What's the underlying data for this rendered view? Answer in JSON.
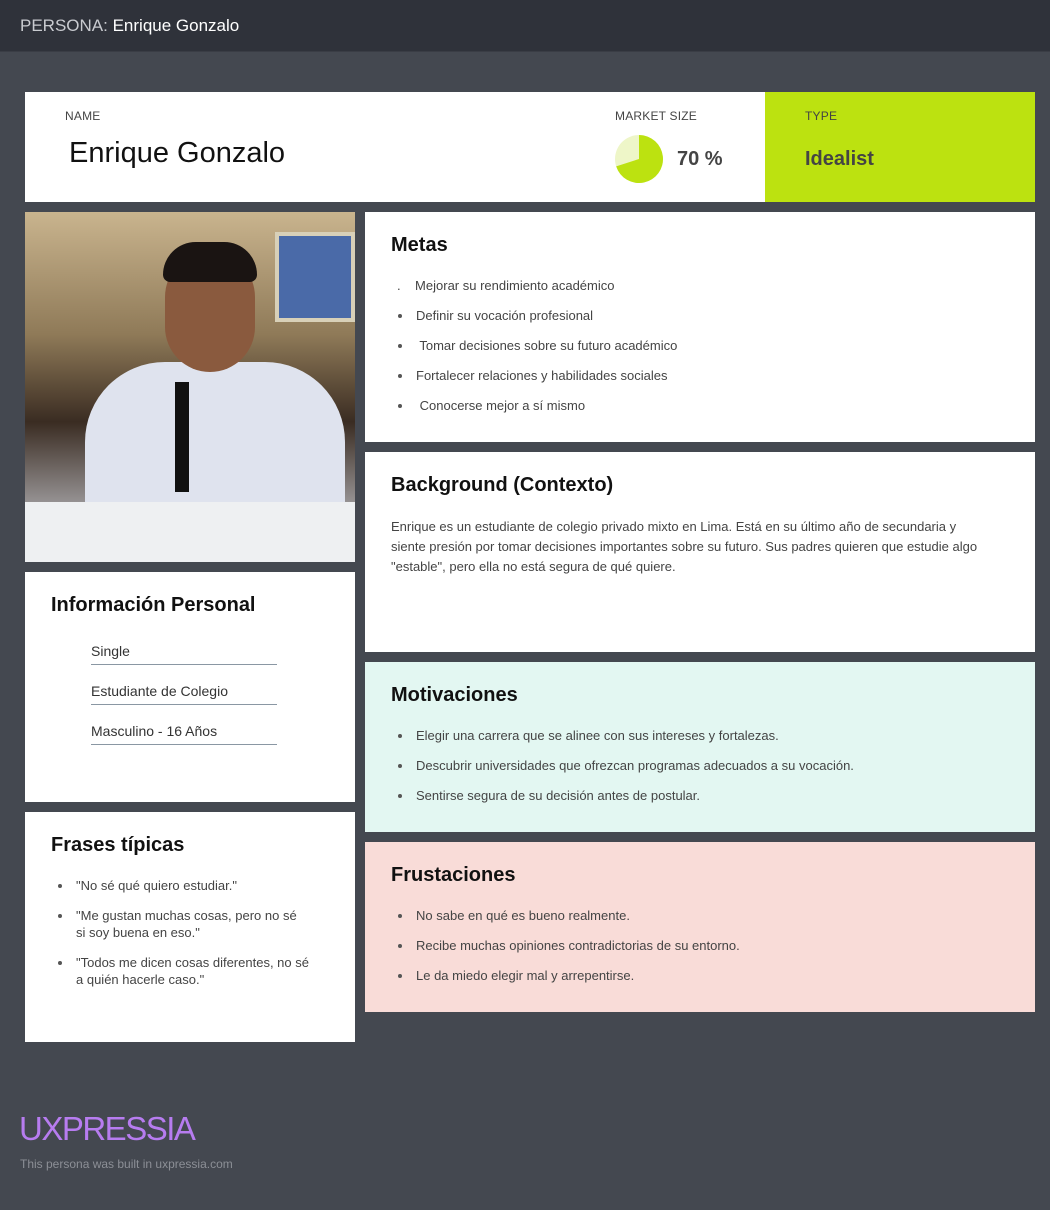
{
  "header": {
    "prefix": "PERSONA:",
    "name": "Enrique Gonzalo"
  },
  "summary": {
    "name_label": "NAME",
    "name": "Enrique Gonzalo",
    "market_label": "MARKET SIZE",
    "market_value": "70 %",
    "market_fraction": 0.7,
    "type_label": "TYPE",
    "type": "Idealist"
  },
  "colors": {
    "accent": "#bce210",
    "motivations_bg": "#e3f7f2",
    "frustrations_bg": "#f9dcd8",
    "brand": "#b77cf0"
  },
  "goals": {
    "title": "Metas",
    "items": [
      ".    Mejorar su rendimiento académico",
      "Definir su vocación profesional",
      " Tomar decisiones sobre su futuro académico",
      "Fortalecer relaciones y habilidades sociales",
      " Conocerse mejor a sí mismo"
    ]
  },
  "background": {
    "title": "Background (Contexto)",
    "text": "Enrique es un estudiante de colegio privado mixto en Lima. Está en su último año de secundaria y siente presión por tomar decisiones importantes sobre su futuro. Sus padres quieren que estudie algo \"estable\", pero ella no está segura de qué quiere."
  },
  "personal": {
    "title": "Información Personal",
    "fields": [
      "Single",
      "Estudiante de Colegio",
      "Masculino - 16 Años"
    ]
  },
  "quotes": {
    "title": "Frases típicas",
    "items": [
      "\"No sé qué quiero estudiar.\"",
      "\"Me gustan muchas cosas, pero no sé si soy buena en eso.\"",
      "\"Todos me dicen cosas diferentes, no sé a quién hacerle caso.\""
    ]
  },
  "motivations": {
    "title": "Motivaciones",
    "items": [
      "Elegir una carrera que se alinee con sus intereses y fortalezas.",
      "Descubrir universidades que ofrezcan programas adecuados a su vocación.",
      "Sentirse segura de su decisión antes de postular."
    ]
  },
  "frustrations": {
    "title": "Frustaciones",
    "items": [
      "No sabe en qué es bueno realmente.",
      "Recibe muchas opiniones contradictorias de su entorno.",
      "Le da miedo elegir mal y arrepentirse."
    ]
  },
  "footer": {
    "logo": "UXPRESSIA",
    "credit": "This persona was built in uxpressia.com"
  }
}
